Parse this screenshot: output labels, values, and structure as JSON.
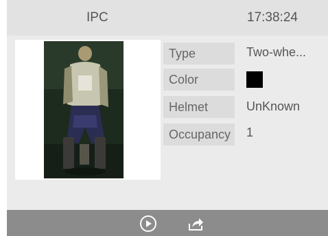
{
  "header": {
    "title": "IPC",
    "time": "17:38:24"
  },
  "attributes": [
    {
      "label": "Type",
      "value": "Two-whe..."
    },
    {
      "label": "Color",
      "value": "",
      "color": "#000000"
    },
    {
      "label": "Helmet",
      "value": "UnKnown"
    },
    {
      "label": "Occupancy",
      "value": "1"
    }
  ],
  "footer": {
    "icons": [
      "play-circle-icon",
      "share-icon"
    ]
  },
  "colors": {
    "card_background": "#ebebeb",
    "header_background": "#e2e2e2",
    "footer_background": "#8c8c8c",
    "label_background": "#dcdcdc"
  }
}
